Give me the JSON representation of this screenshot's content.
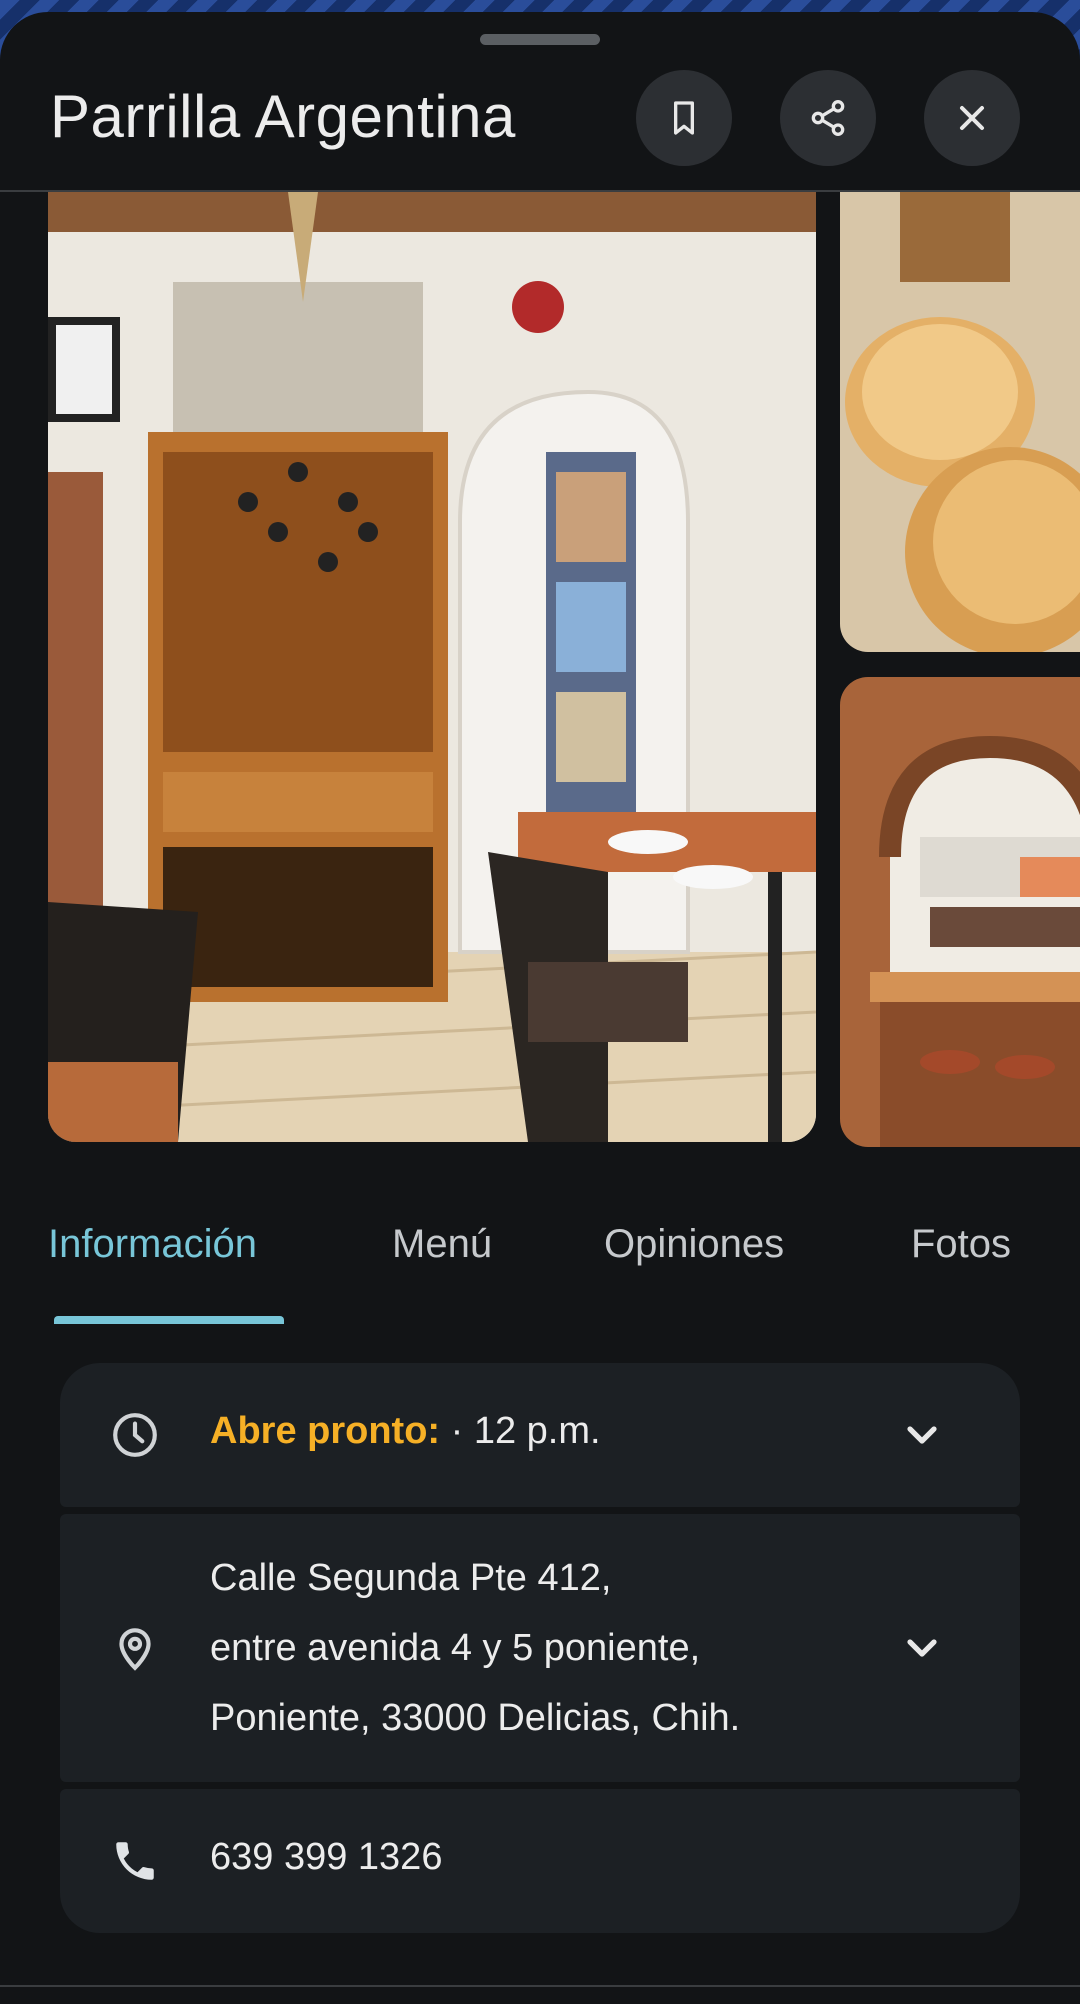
{
  "place": {
    "name": "Parrilla Argentina"
  },
  "header_actions": {
    "save_icon": "bookmark-icon",
    "share_icon": "share-icon",
    "close_icon": "close-icon"
  },
  "photos": [
    {
      "subject": "restaurant interior with wine cabinet"
    },
    {
      "subject": "bread rolls"
    },
    {
      "subject": "brick arch dining room"
    }
  ],
  "tabs": [
    {
      "label": "Información",
      "active": true
    },
    {
      "label": "Menú",
      "active": false
    },
    {
      "label": "Opiniones",
      "active": false
    },
    {
      "label": "Fotos",
      "active": false
    }
  ],
  "info": {
    "hours": {
      "status": "Abre pronto:",
      "time": " · 12 p.m.",
      "icon": "clock-icon"
    },
    "address": {
      "lines": [
        "Calle Segunda Pte 412,",
        "entre avenida 4 y 5 poniente,",
        "Poniente, 33000 Delicias, Chih."
      ],
      "icon": "location-pin-icon"
    },
    "phone": {
      "number": "639 399 1326",
      "icon": "phone-icon"
    }
  },
  "colors": {
    "accent": "#78c6d8",
    "status_open_soon": "#f6b026",
    "background": "#121416",
    "card": "#1c2024"
  }
}
